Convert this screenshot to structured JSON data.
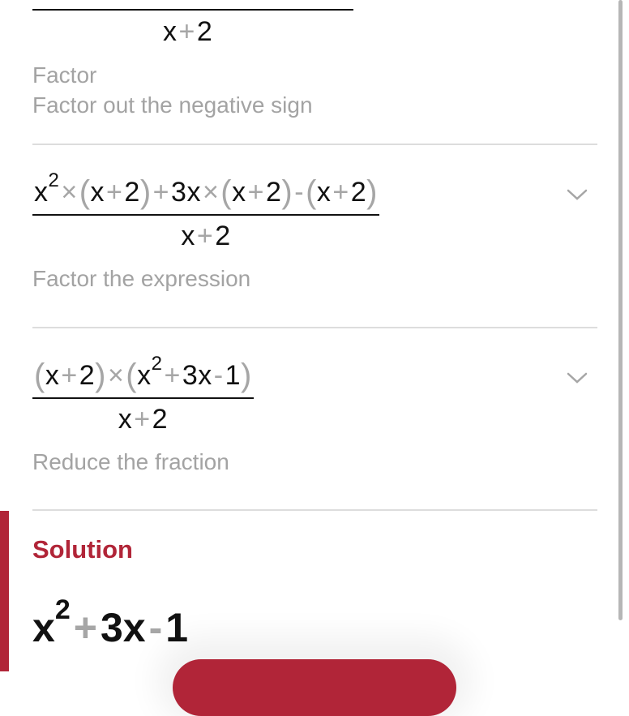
{
  "steps": [
    {
      "denominator": {
        "x": "x",
        "op": "+",
        "c": "2"
      },
      "descriptions": [
        "Factor",
        "Factor out the negative sign"
      ]
    },
    {
      "numerator": {
        "t1_base": "x",
        "t1_exp": "2",
        "times": "×",
        "lp": "(",
        "rp": ")",
        "x": "x",
        "plus": "+",
        "two": "2",
        "coef3": "3",
        "minus": "-"
      },
      "denominator": {
        "x": "x",
        "op": "+",
        "c": "2"
      },
      "descriptions": [
        "Factor the expression"
      ],
      "expand_icon": "chevron-down-icon"
    },
    {
      "numerator": {
        "lp": "(",
        "rp": ")",
        "x": "x",
        "plus": "+",
        "two": "2",
        "times": "×",
        "exp": "2",
        "coef3": "3",
        "minus": "-",
        "one": "1"
      },
      "denominator": {
        "x": "x",
        "op": "+",
        "c": "2"
      },
      "descriptions": [
        "Reduce the fraction"
      ],
      "expand_icon": "chevron-down-icon"
    }
  ],
  "solution": {
    "title": "Solution",
    "base": "x",
    "exp": "2",
    "plus": "+",
    "coef": "3",
    "x": "x",
    "minus": "-",
    "const": "1"
  },
  "colors": {
    "accent": "#b12538",
    "muted_text": "#a3a3a3",
    "divider": "#dddddd"
  }
}
